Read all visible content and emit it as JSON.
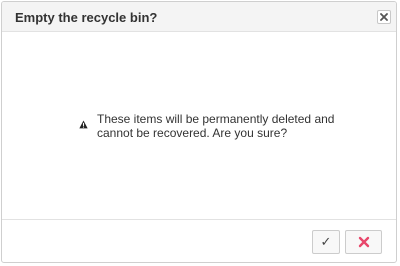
{
  "dialog": {
    "title": "Empty the recycle bin?",
    "message": "These items will be permanently deleted and cannot be recovered. Are you sure?",
    "icons": {
      "close": "close-icon",
      "warning": "warning-icon",
      "confirm": "checkmark-icon",
      "cancel": "cross-icon"
    },
    "confirm_glyph": "✓",
    "colors": {
      "cancel_accent": "#e8476b",
      "titlebar_bg": "#f4f4f4",
      "border": "#cfcfcf"
    }
  }
}
